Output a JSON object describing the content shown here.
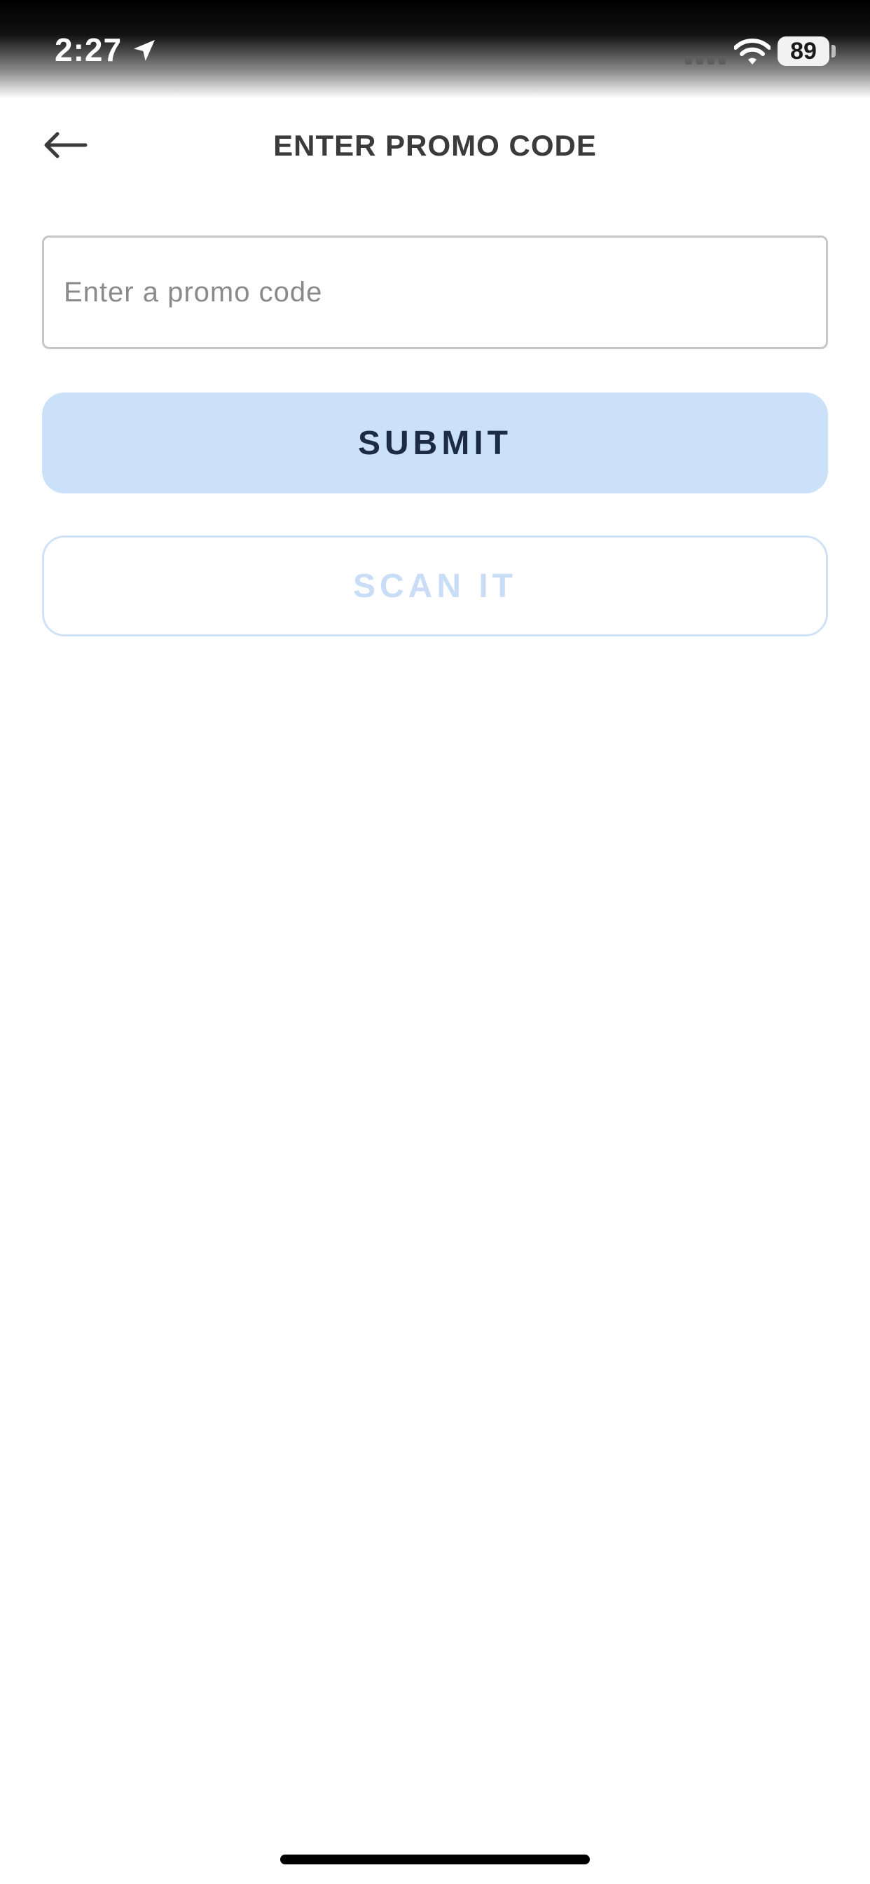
{
  "status_bar": {
    "time": "2:27",
    "battery_level": "89",
    "icons": [
      "location-arrow-icon",
      "cellular-signal-icon",
      "wifi-icon",
      "battery-icon"
    ]
  },
  "header": {
    "back_icon": "arrow-left-icon",
    "title": "ENTER PROMO CODE"
  },
  "promo_form": {
    "input_value": "",
    "input_placeholder": "Enter a promo code",
    "submit_label": "SUBMIT",
    "scan_label": "SCAN IT"
  },
  "colors": {
    "submit_background": "#cbe1fa",
    "submit_text": "#1c2b46",
    "scan_border": "#cfe2f8",
    "scan_text": "#c9ddf6",
    "title_text": "#3b3b3b"
  }
}
